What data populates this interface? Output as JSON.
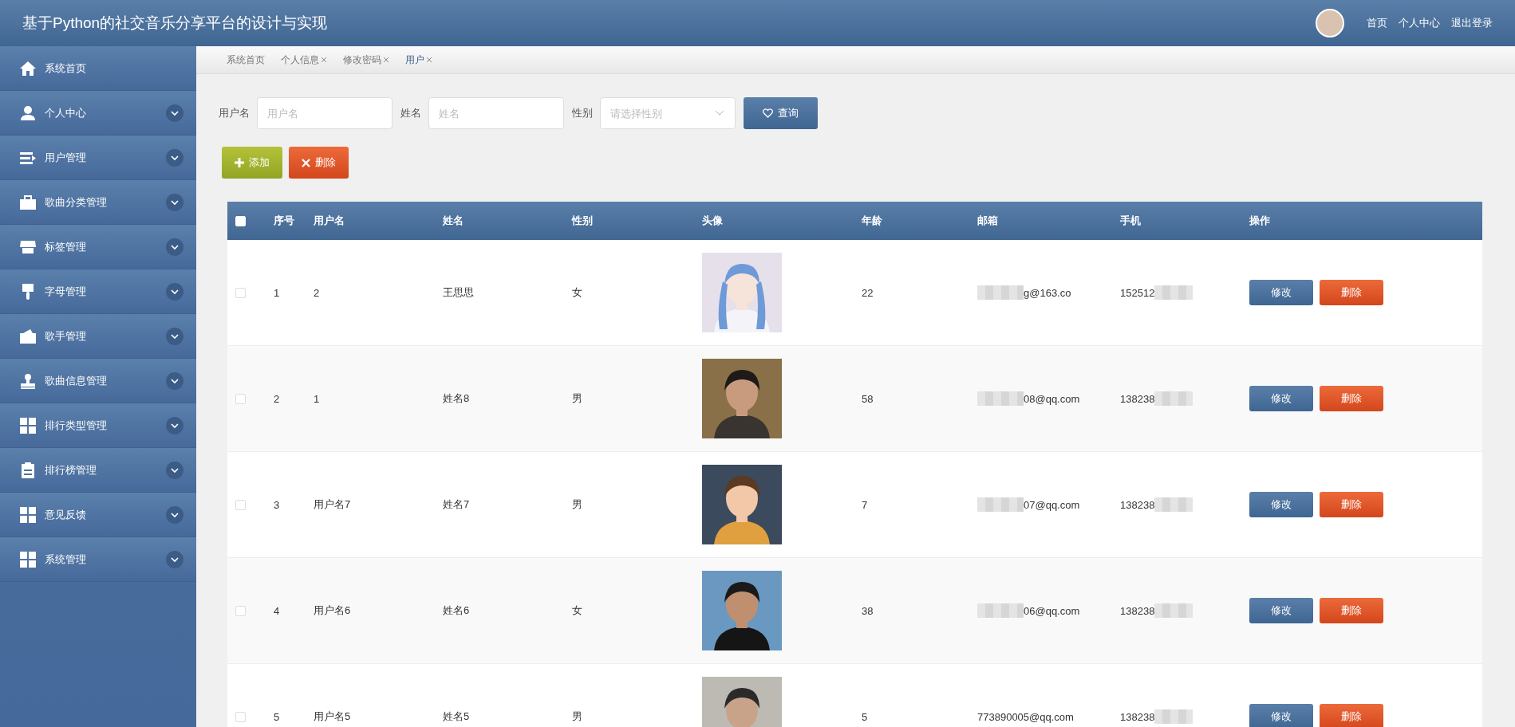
{
  "header": {
    "title": "基于Python的社交音乐分享平台的设计与实现",
    "links": [
      "首页",
      "个人中心",
      "退出登录"
    ]
  },
  "sidebar": {
    "items": [
      {
        "label": "系统首页",
        "kind": "link"
      },
      {
        "label": "个人中心",
        "kind": "menu"
      },
      {
        "label": "用户管理",
        "kind": "menu"
      },
      {
        "label": "歌曲分类管理",
        "kind": "menu"
      },
      {
        "label": "标签管理",
        "kind": "menu"
      },
      {
        "label": "字母管理",
        "kind": "menu"
      },
      {
        "label": "歌手管理",
        "kind": "menu"
      },
      {
        "label": "歌曲信息管理",
        "kind": "menu"
      },
      {
        "label": "排行类型管理",
        "kind": "menu"
      },
      {
        "label": "排行榜管理",
        "kind": "menu"
      },
      {
        "label": "意见反馈",
        "kind": "menu"
      },
      {
        "label": "系统管理",
        "kind": "menu"
      }
    ]
  },
  "tabs": [
    {
      "label": "系统首页",
      "closable": false,
      "selected": false
    },
    {
      "label": "个人信息",
      "closable": true,
      "selected": false
    },
    {
      "label": "修改密码",
      "closable": true,
      "selected": false
    },
    {
      "label": "用户",
      "closable": true,
      "selected": true
    }
  ],
  "search": {
    "fields": [
      {
        "label": "用户名",
        "placeholder": "用户名",
        "kind": "input"
      },
      {
        "label": "姓名",
        "placeholder": "姓名",
        "kind": "input"
      },
      {
        "label": "性别",
        "placeholder": "请选择性别",
        "kind": "select"
      }
    ],
    "button": "查询"
  },
  "actions": [
    {
      "label": "添加",
      "kind": "add"
    },
    {
      "label": "删除",
      "kind": "delete"
    }
  ],
  "table": {
    "select_all": {
      "checked": false
    },
    "columns": [
      "序号",
      "用户名",
      "姓名",
      "性别",
      "头像",
      "年龄",
      "邮箱",
      "手机",
      "操作"
    ],
    "rows": [
      {
        "checked": false,
        "index": "1",
        "username": "2",
        "name": "王思思",
        "gender": "女",
        "avatar": {
          "kind": "picture"
        },
        "age": "22",
        "email": {
          "text": "g@163.co",
          "blurred": true
        },
        "phone": {
          "text": "152512",
          "blurred": true
        },
        "actions": [
          "修改",
          "删除"
        ]
      },
      {
        "checked": false,
        "index": "2",
        "username": "1",
        "name": "姓名8",
        "gender": "男",
        "avatar": {
          "kind": "picture"
        },
        "age": "58",
        "email": {
          "text": "08@qq.com",
          "blurred": true
        },
        "phone": {
          "text": "138238",
          "blurred": true
        },
        "actions": [
          "修改",
          "删除"
        ]
      },
      {
        "checked": false,
        "index": "3",
        "username": "用户名7",
        "name": "姓名7",
        "gender": "男",
        "avatar": {
          "kind": "picture"
        },
        "age": "7",
        "email": {
          "text": "07@qq.com",
          "blurred": true
        },
        "phone": {
          "text": "138238",
          "blurred": true
        },
        "actions": [
          "修改",
          "删除"
        ]
      },
      {
        "checked": false,
        "index": "4",
        "username": "用户名6",
        "name": "姓名6",
        "gender": "女",
        "avatar": {
          "kind": "picture"
        },
        "age": "38",
        "email": {
          "text": "06@qq.com",
          "blurred": true
        },
        "phone": {
          "text": "138238",
          "blurred": true
        },
        "actions": [
          "修改",
          "删除"
        ]
      },
      {
        "checked": false,
        "index": "5",
        "username": "用户名5",
        "name": "姓名5",
        "gender": "男",
        "avatar": {
          "kind": "picture"
        },
        "age": "5",
        "email": {
          "text": "773890005@qq.com",
          "blurred": false
        },
        "phone": {
          "text": "138238",
          "blurred": true
        },
        "actions": [
          "修改",
          "删除"
        ]
      }
    ]
  }
}
